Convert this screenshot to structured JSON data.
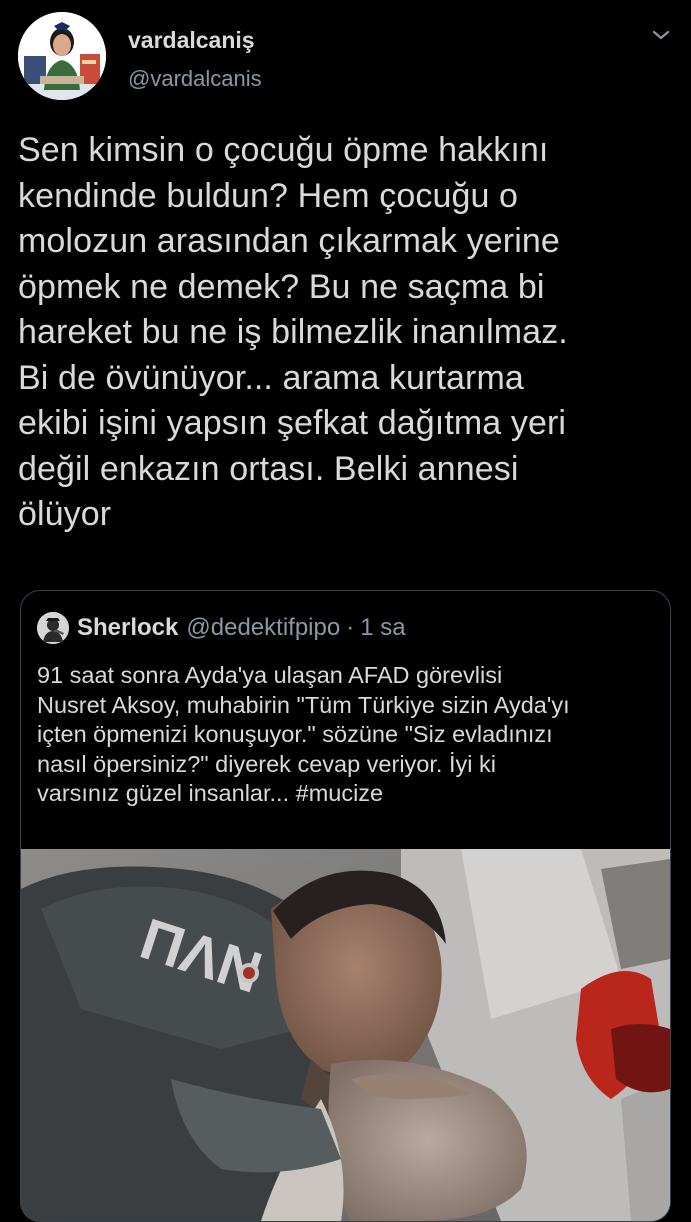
{
  "tweet": {
    "display_name": "vardalcaniş",
    "handle": "@vardalcanis",
    "text": "Sen kimsin o çocuğu öpme hakkını\nkendinde buldun? Hem çocuğu o\nmolozun arasından çıkarmak yerine\nöpmek ne demek? Bu ne saçma bi\nhareket bu ne iş bilmezlik inanılmaz.\nBi de övünüyor... arama kurtarma\nekibi işini yapsın şefkat dağıtma yeri\ndeğil enkazın ortası. Belki annesi\nölüyor"
  },
  "quoted": {
    "display_name": "Sherlock",
    "handle": "@dedektifpipo",
    "separator": "·",
    "time": "1 sa",
    "text": "91 saat sonra Ayda'ya ulaşan AFAD görevlisi\nNusret Aksoy, muhabirin \"Tüm Türkiye sizin Ayda'yı\niçten öpmenizi konuşuyor.\" sözüne \"Siz evladınızı\nnasıl öpersiniz?\" diyerek cevap veriyor. İyi ki\nvarsınız güzel insanlar... #mucize",
    "photo_icon": "rescue-photo"
  },
  "icons": {
    "menu": "chevron-down-icon",
    "avatar": "avatar-image",
    "quoted_avatar": "avatar-image"
  },
  "colors": {
    "background": "#000000",
    "text": "#d9d9d9",
    "secondary_text": "#8899a6",
    "card_border": "#38444d"
  }
}
